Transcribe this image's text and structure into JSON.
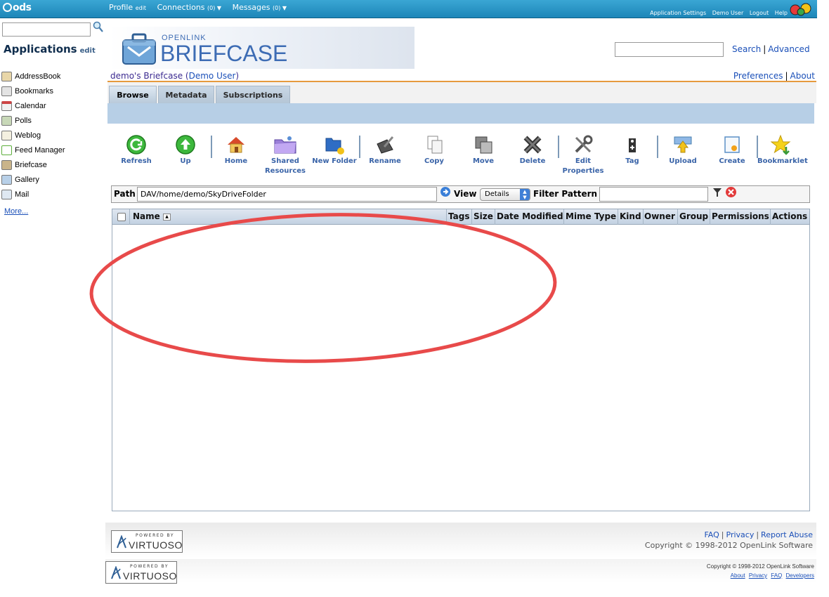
{
  "topbar": {
    "logo": "ods",
    "nav": [
      {
        "label": "Profile",
        "suffix": "edit"
      },
      {
        "label": "Connections",
        "suffix": "(0) ▼"
      },
      {
        "label": "Messages",
        "suffix": "(0) ▼"
      }
    ],
    "right_links": [
      "Application Settings",
      "Demo User",
      "Logout",
      "Help"
    ]
  },
  "sidebar": {
    "title": "Applications",
    "edit": "edit",
    "items": [
      {
        "label": "AddressBook",
        "icon": "addressbook-icon"
      },
      {
        "label": "Bookmarks",
        "icon": "bookmarks-icon"
      },
      {
        "label": "Calendar",
        "icon": "calendar-icon"
      },
      {
        "label": "Polls",
        "icon": "polls-icon"
      },
      {
        "label": "Weblog",
        "icon": "weblog-icon"
      },
      {
        "label": "Feed Manager",
        "icon": "feed-icon"
      },
      {
        "label": "Briefcase",
        "icon": "briefcase-icon"
      },
      {
        "label": "Gallery",
        "icon": "gallery-icon"
      },
      {
        "label": "Mail",
        "icon": "mail-icon"
      }
    ],
    "more": "More..."
  },
  "header": {
    "brand_small": "OPENLINK",
    "brand": "BRIEFCASE",
    "search_link": "Search",
    "advanced_link": "Advanced",
    "owner_prefix": "demo's Briefcase (",
    "owner_user": "Demo User",
    "owner_suffix": ")",
    "preferences": "Preferences",
    "about": "About"
  },
  "tabs": [
    {
      "label": "Browse",
      "active": true
    },
    {
      "label": "Metadata",
      "active": false
    },
    {
      "label": "Subscriptions",
      "active": false
    }
  ],
  "toolbar": {
    "buttons": [
      {
        "label": "Refresh",
        "icon": "refresh-icon"
      },
      {
        "label": "Up",
        "icon": "up-arrow-icon"
      },
      {
        "label": "Home",
        "icon": "home-icon"
      },
      {
        "label": "Shared Resources",
        "icon": "shared-folder-icon"
      },
      {
        "label": "New Folder",
        "icon": "new-folder-icon"
      },
      {
        "label": "Rename",
        "icon": "rename-icon"
      },
      {
        "label": "Copy",
        "icon": "copy-icon"
      },
      {
        "label": "Move",
        "icon": "move-icon"
      },
      {
        "label": "Delete",
        "icon": "delete-icon"
      },
      {
        "label": "Edit Properties",
        "icon": "edit-properties-icon"
      },
      {
        "label": "Tag",
        "icon": "tag-icon"
      },
      {
        "label": "Upload",
        "icon": "upload-icon"
      },
      {
        "label": "Create",
        "icon": "create-icon"
      },
      {
        "label": "Bookmarklet",
        "icon": "bookmarklet-icon"
      }
    ]
  },
  "pathbar": {
    "path_label": "Path",
    "path_value": "DAV/home/demo/SkyDriveFolder",
    "view_label": "View",
    "view_value": "Details",
    "filter_label": "Filter Pattern",
    "filter_value": ""
  },
  "grid": {
    "columns": [
      "Name",
      "Tags",
      "Size",
      "Date Modified",
      "Mime Type",
      "Kind",
      "Owner",
      "Group",
      "Permissions",
      "Actions"
    ],
    "rows": []
  },
  "footer": {
    "powered_by": "POWERED BY",
    "virtuoso": "VIRTUOSO",
    "links": [
      "FAQ",
      "Privacy",
      "Report Abuse"
    ],
    "copyright": "Copyright © 1998-2012 OpenLink Software",
    "bottom_copyright": "Copyright © 1998-2012 OpenLink Software",
    "bottom_links": [
      "About",
      "Privacy",
      "FAQ",
      "Developers"
    ]
  },
  "colors": {
    "topbar": "#1d86b8",
    "accent_link": "#1a4fb8",
    "annotation": "#e84a4a",
    "rule": "#e69a3d"
  }
}
